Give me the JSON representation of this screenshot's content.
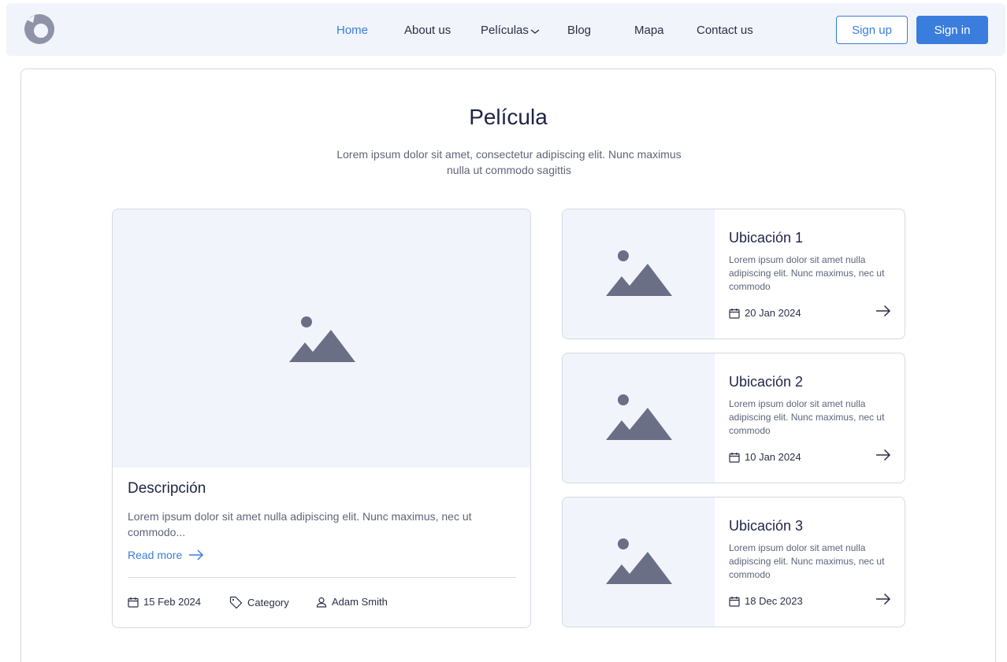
{
  "nav": {
    "logo": "logo-icon",
    "links": [
      "Home",
      "About us",
      "Películas",
      "Blog",
      "Mapa",
      "Contact us"
    ],
    "active_link": "Home",
    "signup_label": "Sign up",
    "signin_label": "Sign in"
  },
  "colors": {
    "accent": "#3b7ddd",
    "nav_bg": "#f1f4fb",
    "placeholder_bg": "#f1f4fb",
    "placeholder_icon": "#6b6f86",
    "text_dark": "#1f2347",
    "text_muted": "#5f647a",
    "border": "#d6d9e3"
  },
  "header": {
    "title": "Película",
    "subtitle": "Lorem ipsum dolor sit amet, consectetur adipiscing elit. Nunc maximus nulla ut commodo sagittis"
  },
  "featured": {
    "image": "image-placeholder-icon",
    "title": "Descripción",
    "description": "Lorem ipsum dolor sit amet nulla adipiscing elit. Nunc maximus, nec ut commodo...",
    "read_more": "Read more",
    "date": "15 Feb 2024",
    "category": "Category",
    "author": "Adam Smith"
  },
  "locations": [
    {
      "title": "Ubicación 1",
      "description": "Lorem ipsum dolor sit amet nulla adipiscing elit. Nunc maximus, nec ut commodo",
      "date": "20 Jan 2024"
    },
    {
      "title": "Ubicación 2",
      "description": "Lorem ipsum dolor sit amet nulla adipiscing elit. Nunc maximus, nec ut commodo",
      "date": "10 Jan 2024"
    },
    {
      "title": "Ubicación 3",
      "description": "Lorem ipsum dolor sit amet nulla adipiscing elit. Nunc maximus, nec ut commodo",
      "date": "18 Dec 2023"
    }
  ]
}
